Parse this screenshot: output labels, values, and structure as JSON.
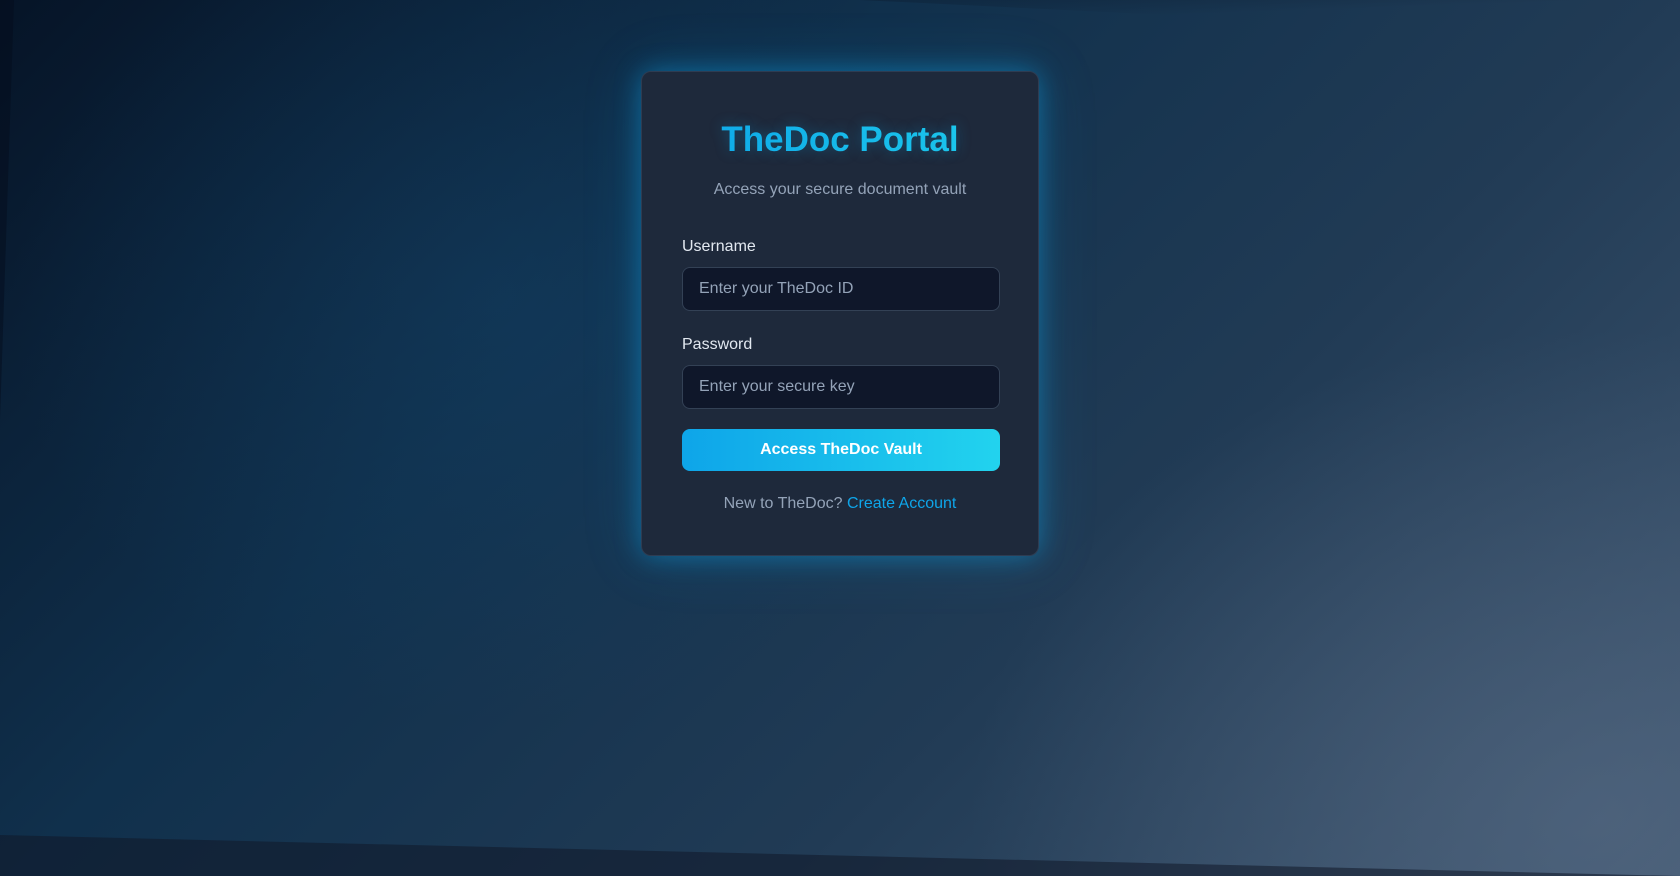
{
  "login": {
    "title": "TheDoc Portal",
    "subtitle": "Access your secure document vault",
    "username": {
      "label": "Username",
      "value": "",
      "placeholder": "Enter your TheDoc ID"
    },
    "password": {
      "label": "Password",
      "value": "",
      "placeholder": "Enter your secure key"
    },
    "submit_label": "Access TheDoc Vault",
    "footer": {
      "prompt": "New to TheDoc?",
      "link_label": "Create Account"
    }
  },
  "colors": {
    "accent": "#0ea5e9",
    "accent_light": "#22d3ee",
    "card_bg": "#1e293b",
    "input_bg": "#0f172a",
    "muted_text": "#94a3b8",
    "label_text": "#e2e8f0"
  }
}
